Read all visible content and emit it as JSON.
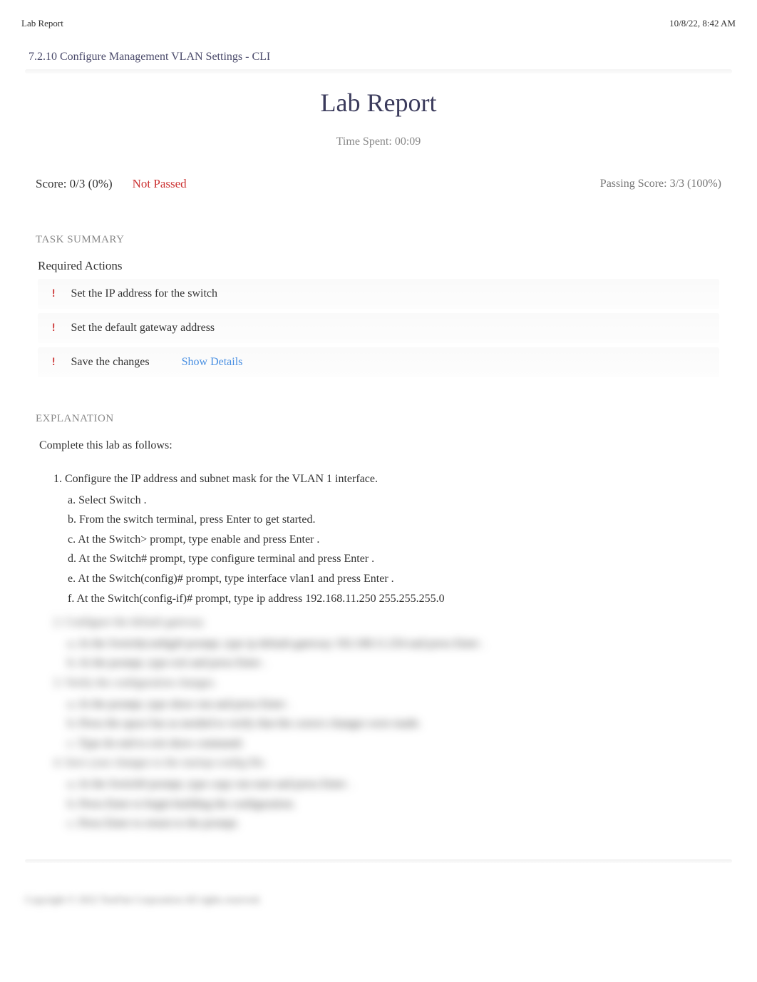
{
  "header": {
    "left": "Lab Report",
    "right": "10/8/22, 8:42 AM"
  },
  "breadcrumb": "7.2.10 Configure Management VLAN Settings - CLI",
  "title": "Lab Report",
  "time_spent": "Time Spent: 00:09",
  "score": {
    "label": "Score: 0/3 (0%)",
    "status": "Not Passed",
    "passing": "Passing Score: 3/3 (100%)"
  },
  "task_summary": {
    "heading": "TASK SUMMARY",
    "required_title": "Required Actions",
    "items": [
      {
        "text": "Set the IP address for the switch"
      },
      {
        "text": "Set the default gateway address"
      },
      {
        "text": "Save the changes",
        "details": "Show Details"
      }
    ]
  },
  "explanation": {
    "heading": "EXPLANATION",
    "intro": "Complete this lab as follows:",
    "step1": {
      "title": "1. Configure the IP address and subnet mask for the VLAN 1 interface.",
      "a": "a.  Select   Switch .",
      "b": "b. From the switch terminal, press         Enter   to get started.",
      "c": " c. At the Switch> prompt, type       enable    and press    Enter  .",
      "d": "d. At the Switch# prompt, type        configure terminal        and press    Enter .",
      "e": "e. At the Switch(config)# prompt, type         interface vlan1      and press    Enter .",
      "f": " f. At the Switch(config-if)# prompt, type         ip address 192.168.11.250 255.255.255.0"
    },
    "blurred_steps": [
      "2. Configure the default gateway.",
      "a. At the Switch(config)# prompt, type      ip default-gateway 192.168.11.254       and press   Enter .",
      "b. At the prompt, type      exit   and press   Enter .",
      "3. Verify the configuration changes.",
      "a. At the prompt, type      show run    and press    Enter .",
      "b. Press the    space bar    as needed to verify that the correct changes were made.",
      "c. Type   do end    to exit show command.",
      "4. Save your changes to the startup-config file.",
      "a. At the Switch# prompt, type       copy run start      and press    Enter .",
      "b.  Press   Enter   to begin building the configuration.",
      "c.  Press   Enter   to return to the prompt."
    ]
  },
  "copyright": "Copyright © 2022 TestOut Corporation All rights reserved."
}
